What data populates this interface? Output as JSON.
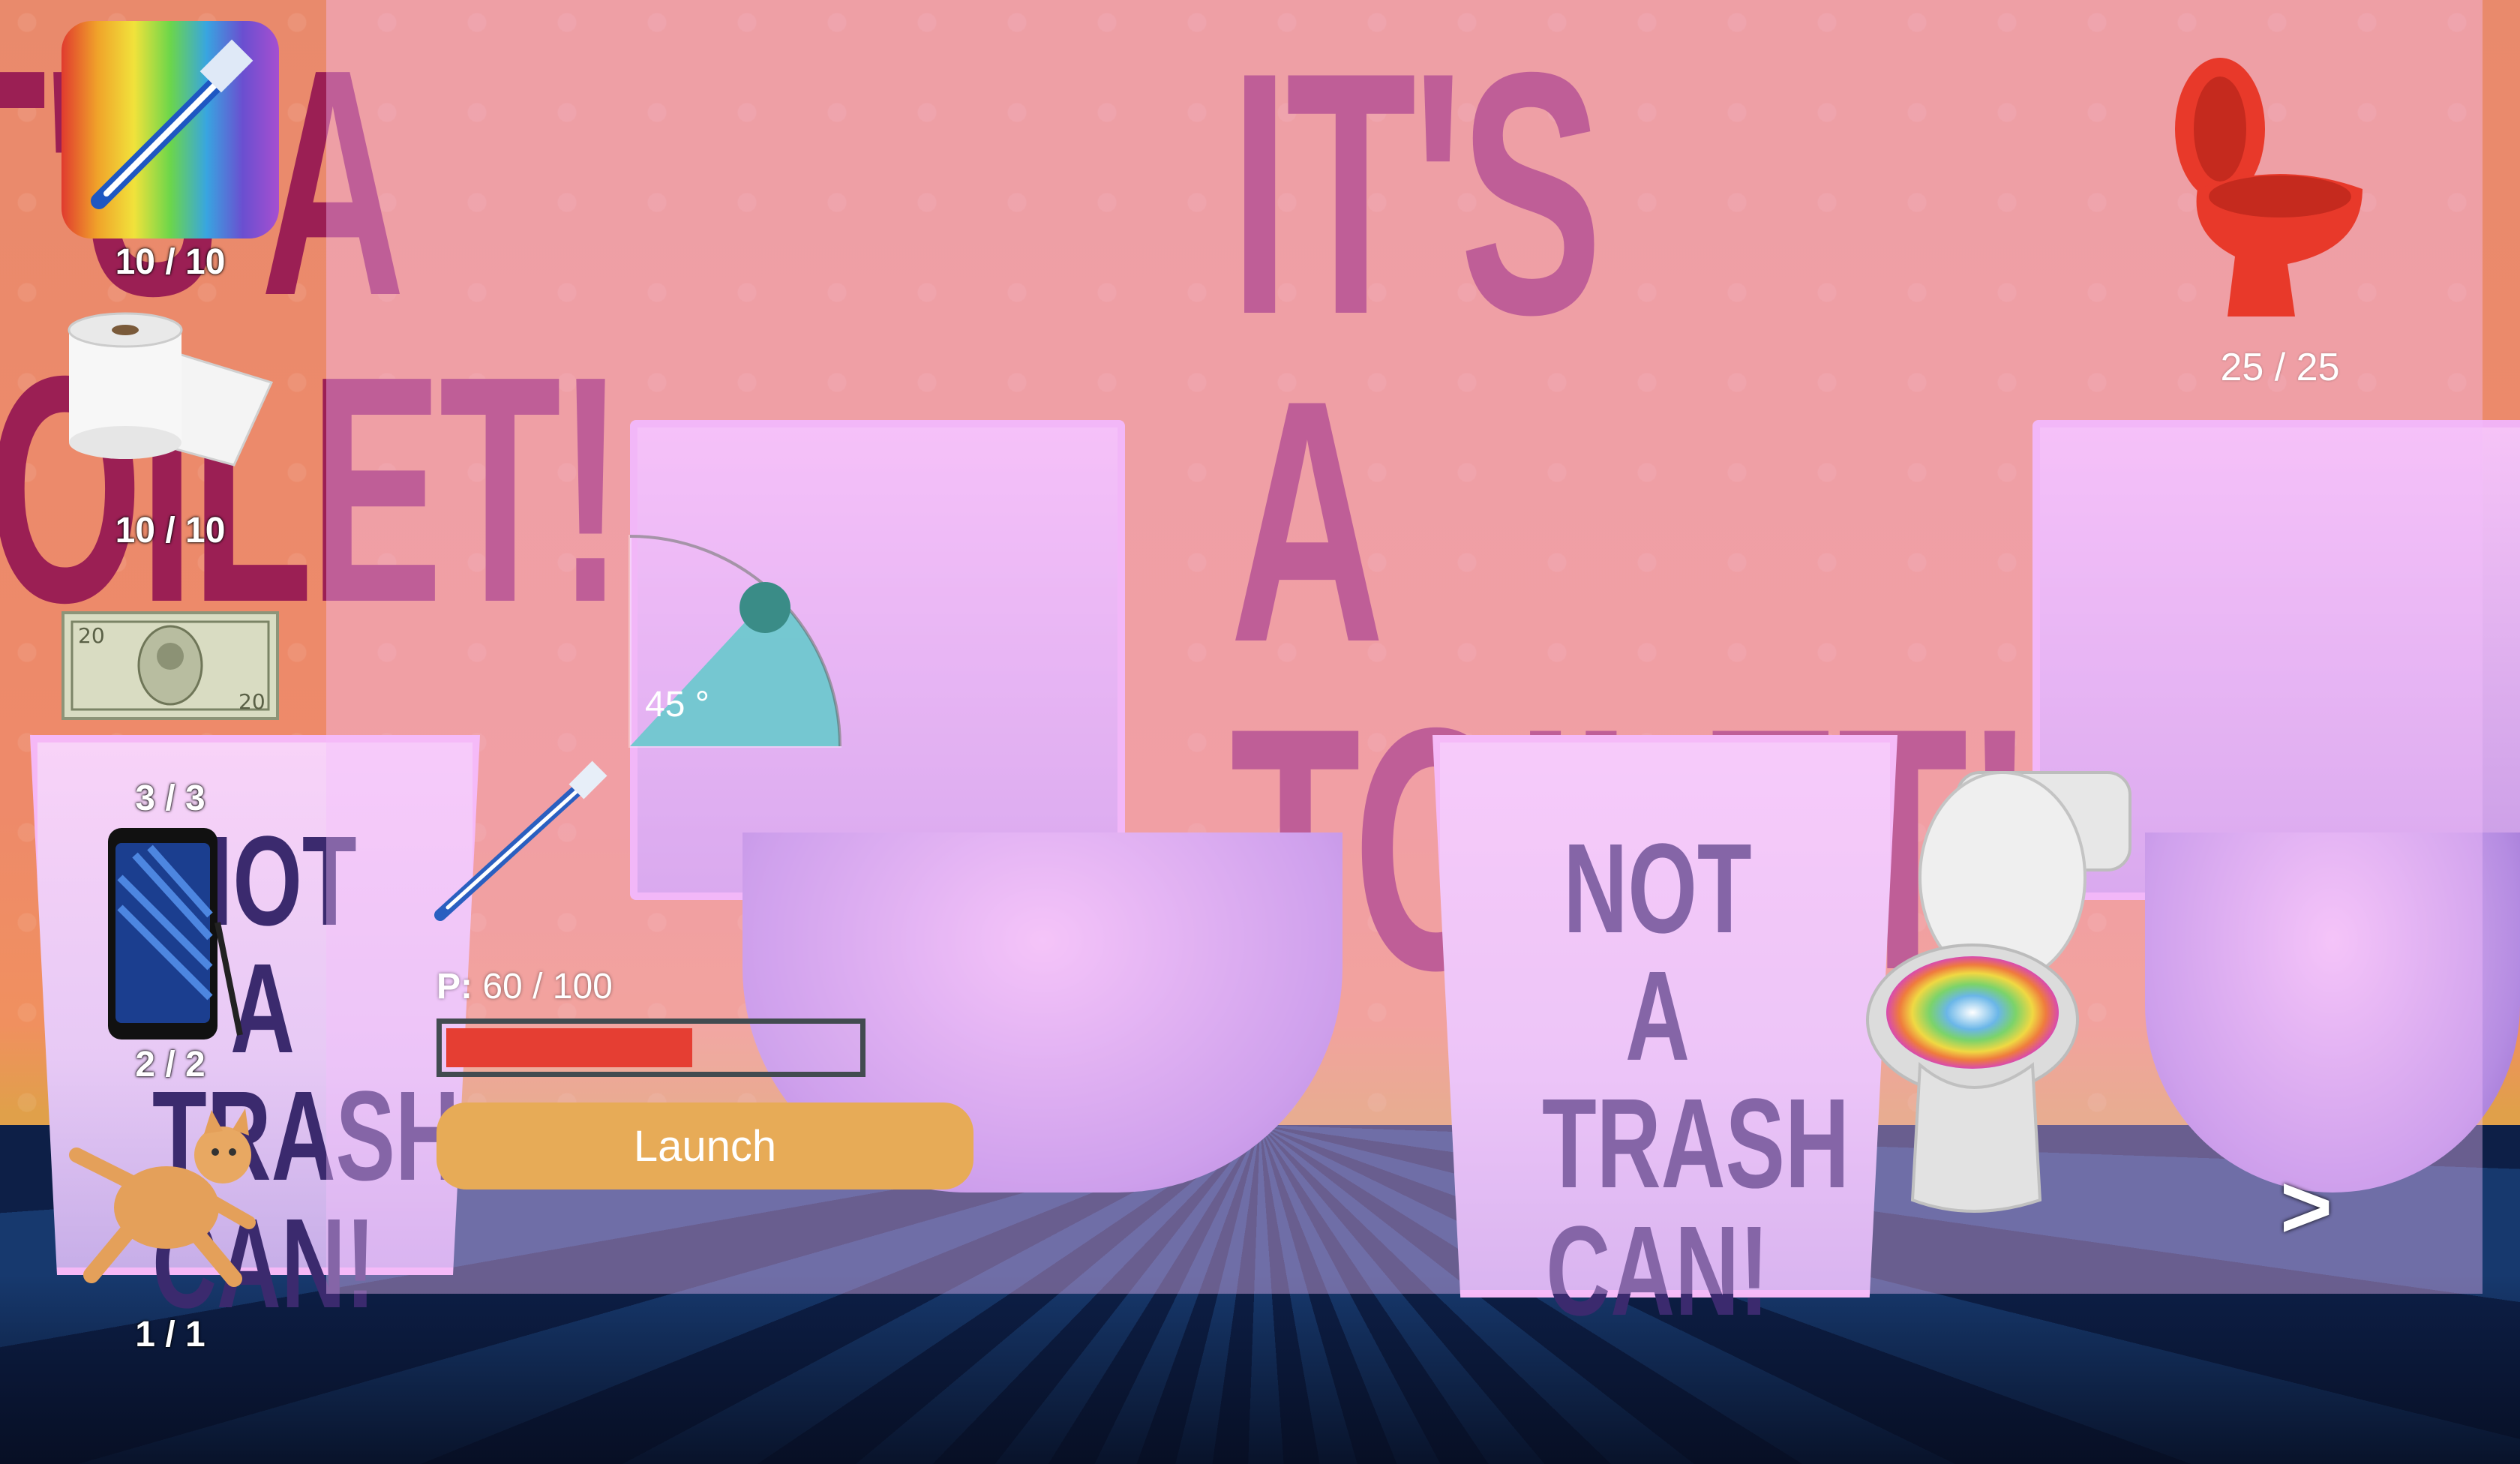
{
  "background": {
    "slogan_line1": "IT'S A",
    "slogan_line2": "TOILET!",
    "can_text_line1": "NOT A",
    "can_text_line2": "TRASH",
    "can_text_line3": "CAN!"
  },
  "inventory": [
    {
      "name": "toothbrush",
      "count": "10 / 10"
    },
    {
      "name": "toilet-paper",
      "count": "10 / 10"
    },
    {
      "name": "twenty-dollar-bill",
      "count": "3 / 3"
    },
    {
      "name": "smartphone",
      "count": "2 / 2"
    },
    {
      "name": "cat",
      "count": "1 / 1"
    }
  ],
  "launcher": {
    "angle_label": "45 °",
    "angle": 45,
    "power_prefix": "P:",
    "power_value": "60 / 100",
    "power": 60,
    "power_max": 100,
    "launch_label": "Launch"
  },
  "score": {
    "icon": "toilet-icon",
    "value": "25 / 25"
  },
  "nav": {
    "next_label": ">"
  },
  "colors": {
    "power_fill": "#e53e33",
    "launch": "#e7ab57",
    "slogan": "#9b1f54",
    "score_icon": "#e8392a"
  }
}
